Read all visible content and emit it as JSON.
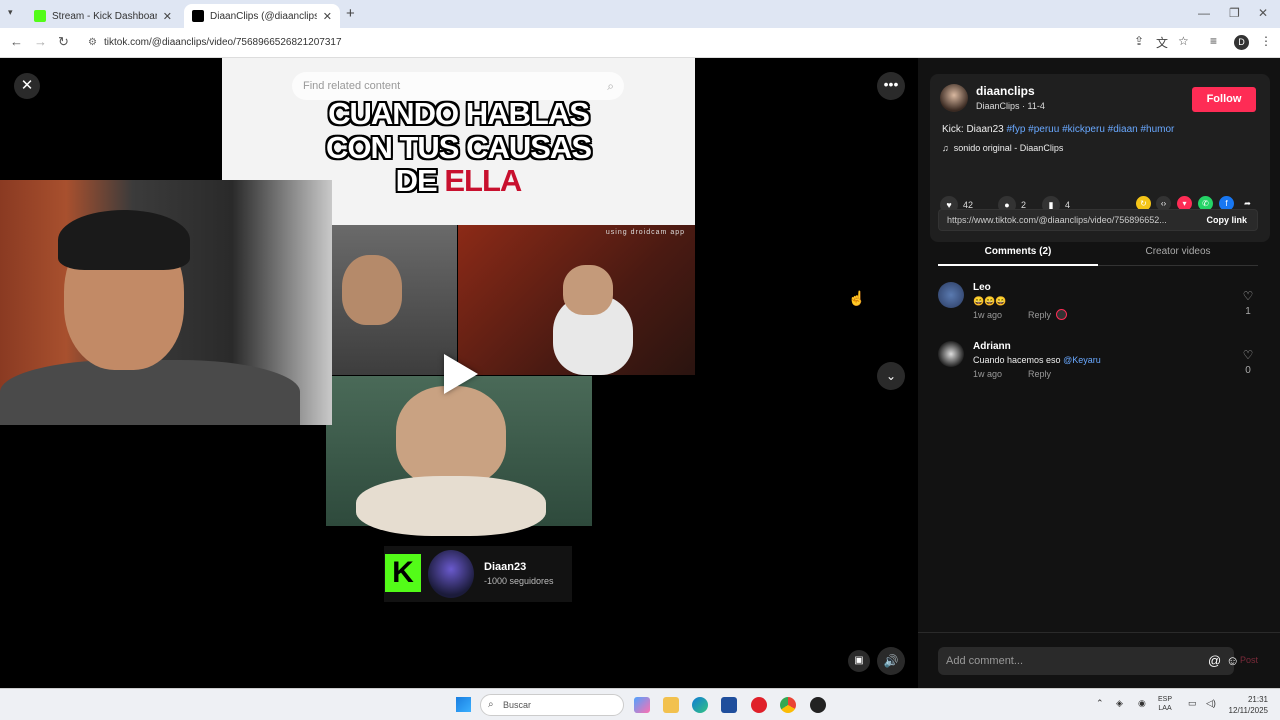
{
  "browser": {
    "tabs": [
      {
        "title": "Stream - Kick Dashboard",
        "favicon_color": "#53fc18"
      },
      {
        "title": "DiaanClips (@diaanclips) | TikTo",
        "favicon_color": "#000000"
      }
    ],
    "url": "tiktok.com/@diaanclips/video/7568966526821207317"
  },
  "video": {
    "search_placeholder": "Find related content",
    "caption_line1": "CUANDO HABLAS",
    "caption_line2": "CON TUS CAUSAS",
    "caption_line3_a": "DE",
    "caption_line3_b": "ELLA",
    "watermark": "using droidcam app",
    "kick_name": "Diaan23",
    "kick_followers": "-1000 seguidores"
  },
  "panel": {
    "username": "diaanclips",
    "subinfo": "DiaanClips · 11-4",
    "follow_label": "Follow",
    "desc_prefix": "Kick: Diaan23",
    "desc_tags": "#fyp #peruu #kickperu #diaan #humor",
    "sound": "sonido original - DiaanClips",
    "likes": "42",
    "comments_count": "2",
    "saves": "4",
    "link": "https://www.tiktok.com/@diaanclips/video/756896652...",
    "copy_label": "Copy link",
    "tab_comments": "Comments (2)",
    "tab_creator": "Creator videos",
    "comments": [
      {
        "name": "Leo",
        "text": "😄😄😄",
        "time": "1w ago",
        "reply": "Reply",
        "likes": "1"
      },
      {
        "name": "Adriann",
        "text": "Cuando hacemos eso",
        "mention": "@Keyaru",
        "time": "1w ago",
        "reply": "Reply",
        "likes": "0"
      }
    ],
    "add_comment_placeholder": "Add comment...",
    "post_label": "Post"
  },
  "taskbar": {
    "search_label": "Buscar",
    "lang_line1": "ESP",
    "lang_line2": "LAA",
    "time": "21:31",
    "date": "12/11/2025"
  }
}
